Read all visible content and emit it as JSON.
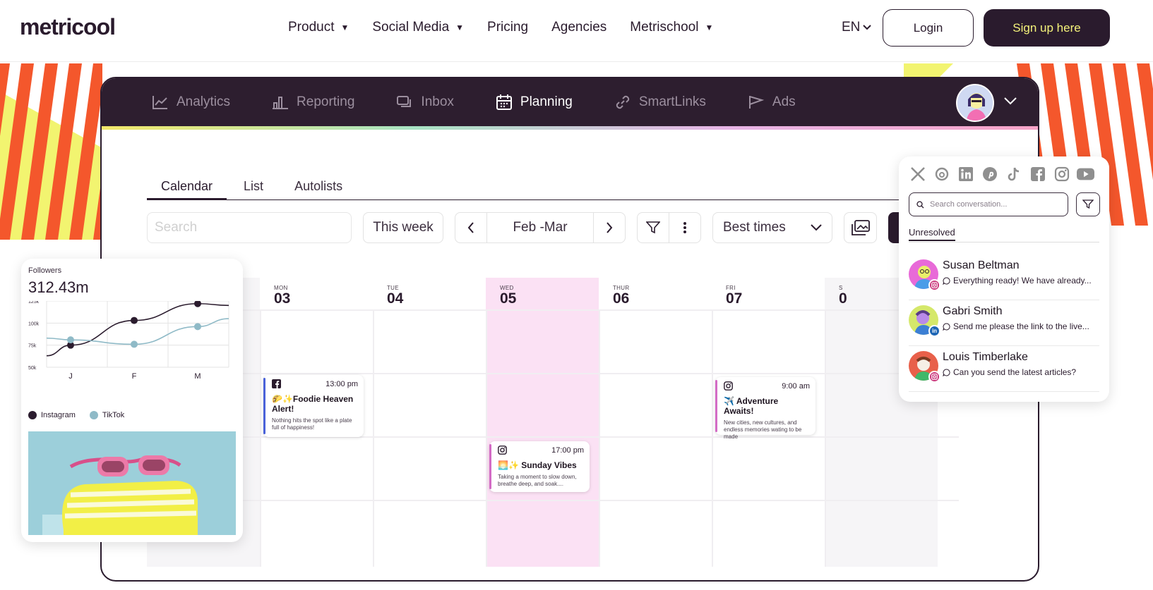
{
  "site": {
    "logo": "metricool",
    "nav": [
      {
        "label": "Product",
        "caret": "▼"
      },
      {
        "label": "Social Media",
        "caret": "▼"
      },
      {
        "label": "Pricing",
        "caret": ""
      },
      {
        "label": "Agencies",
        "caret": ""
      },
      {
        "label": "Metrischool",
        "caret": "▼"
      }
    ],
    "lang": "EN",
    "login": "Login",
    "signup": "Sign up here"
  },
  "app": {
    "tabs": [
      {
        "label": "Analytics",
        "icon": "analytics-icon"
      },
      {
        "label": "Reporting",
        "icon": "reporting-icon"
      },
      {
        "label": "Inbox",
        "icon": "inbox-icon"
      },
      {
        "label": "Planning",
        "icon": "planning-icon"
      },
      {
        "label": "SmartLinks",
        "icon": "smartlinks-icon"
      },
      {
        "label": "Ads",
        "icon": "ads-icon"
      }
    ],
    "subtabs": [
      "Calendar",
      "List",
      "Autolists"
    ],
    "toolbar": {
      "search_placeholder": "Search",
      "week": "This week",
      "range": "Feb -Mar",
      "best": "Best times"
    },
    "days": [
      {
        "name": "MON",
        "date": "03"
      },
      {
        "name": "TUE",
        "date": "04"
      },
      {
        "name": "WED",
        "date": "05"
      },
      {
        "name": "THUR",
        "date": "06"
      },
      {
        "name": "FRI",
        "date": "07"
      },
      {
        "name": "S",
        "date": "0"
      }
    ],
    "posts": [
      {
        "time": "13:00 pm",
        "emoji": "🌮✨",
        "title": "Foodie Heaven Alert!",
        "body": "Nothing hits the spot like a plate full of happiness!",
        "network": "facebook",
        "color": "#4a62d9"
      },
      {
        "time": "17:00 pm",
        "emoji": "🌅✨",
        "title": "Sunday Vibes",
        "body": "Taking a moment to slow down, breathe deep, and soak....",
        "network": "instagram",
        "color": "#d36bc5"
      },
      {
        "time": "9:00 am",
        "emoji": "✈️",
        "title": "Adventure Awaits!",
        "body": "New cities, new cultures, and endless memories wating to be made",
        "network": "instagram",
        "color": "#d36bc5"
      }
    ]
  },
  "followers": {
    "title": "Followers",
    "value": "312.43m",
    "legend": [
      {
        "name": "Instagram",
        "color": "#2b1c2e"
      },
      {
        "name": "TikTok",
        "color": "#8fbac7"
      }
    ]
  },
  "chart_data": {
    "type": "line",
    "title": "Followers",
    "categories": [
      "J",
      "F",
      "M"
    ],
    "ylim": [
      50000,
      125000
    ],
    "yticks": [
      "125k",
      "100k",
      "75k",
      "50k"
    ],
    "series": [
      {
        "name": "Instagram",
        "values": [
          75000,
          103000,
          122000
        ]
      },
      {
        "name": "TikTok",
        "values": [
          81000,
          76000,
          96000
        ]
      }
    ]
  },
  "inbox": {
    "networks": [
      "x-icon",
      "threads-icon",
      "linkedin-icon",
      "pinterest-icon",
      "tiktok-icon",
      "facebook-icon",
      "instagram-icon",
      "youtube-icon"
    ],
    "search_placeholder": "Search conversation...",
    "tab": "Unresolved",
    "conversations": [
      {
        "name": "Susan Beltman",
        "message": "Everything ready! We have already...",
        "badge": "instagram",
        "badge_color": "#c9357a",
        "avatar_bg": "#e86ad8"
      },
      {
        "name": "Gabri Smith",
        "message": "Send me please the link to the live...",
        "badge": "in",
        "badge_color": "#1d66b5",
        "avatar_bg": "#d5e86a"
      },
      {
        "name": "Louis Timberlake",
        "message": "Can you send  the latest articles?",
        "badge": "instagram",
        "badge_color": "#c9357a",
        "avatar_bg": "#e8604a"
      }
    ]
  },
  "colors": {
    "brand_dark": "#2a1b2d",
    "accent_yellow": "#f4f27a",
    "highlight_pink": "#fbe1f4"
  }
}
